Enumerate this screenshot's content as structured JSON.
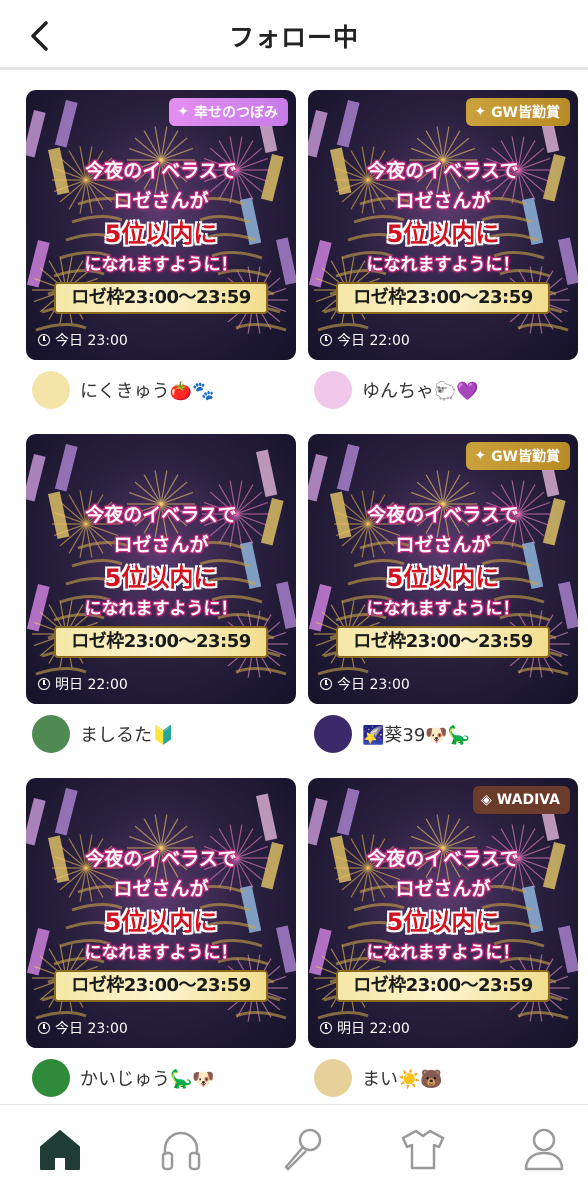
{
  "header": {
    "title": "フォロー中"
  },
  "cards": [
    {
      "badge": "幸せのつぼみ",
      "badge_style": "pink",
      "badge_icon": "sparkle-icon",
      "line1": "今夜のイベラスで",
      "line2": "ロゼさんが",
      "line3": "5位以内に",
      "line4": "になれますように！",
      "slot": "ロゼ枠23:00〜23:59",
      "time": "今日 23:00",
      "user": "にくきゅう🍅🐾",
      "avatar_color": "#f4e4a8"
    },
    {
      "badge": "GW皆勤賞",
      "badge_style": "gold",
      "badge_icon": "sparkle-icon",
      "line1": "今夜のイベラスで",
      "line2": "ロゼさんが",
      "line3": "5位以内に",
      "line4": "になれますように！",
      "slot": "ロゼ枠23:00〜23:59",
      "time": "今日 22:00",
      "user": "ゆんちゃ🐑💜",
      "avatar_color": "#f0c7e8"
    },
    {
      "badge": "",
      "badge_style": "",
      "badge_icon": "",
      "line1": "今夜のイベラスで",
      "line2": "ロゼさんが",
      "line3": "5位以内に",
      "line4": "になれますように！",
      "slot": "ロゼ枠23:00〜23:59",
      "time": "明日 22:00",
      "user": "ましるた🔰",
      "avatar_color": "#4f8a52"
    },
    {
      "badge": "GW皆勤賞",
      "badge_style": "gold",
      "badge_icon": "sparkle-icon",
      "line1": "今夜のイベラスで",
      "line2": "ロゼさんが",
      "line3": "5位以内に",
      "line4": "になれますように！",
      "slot": "ロゼ枠23:00〜23:59",
      "time": "今日 23:00",
      "user": "🌠葵39🐶🦕",
      "avatar_color": "#3a2a6a"
    },
    {
      "badge": "",
      "badge_style": "",
      "badge_icon": "",
      "line1": "今夜のイベラスで",
      "line2": "ロゼさんが",
      "line3": "5位以内に",
      "line4": "になれますように！",
      "slot": "ロゼ枠23:00〜23:59",
      "time": "今日 23:00",
      "user": "かいじゅう🦕🐶",
      "avatar_color": "#2f8a3a"
    },
    {
      "badge": "WADIVA",
      "badge_style": "brown",
      "badge_icon": "diamond-icon",
      "line1": "今夜のイベラスで",
      "line2": "ロゼさんが",
      "line3": "5位以内に",
      "line4": "になれますように！",
      "slot": "ロゼ枠23:00〜23:59",
      "time": "明日 22:00",
      "user": "まい☀️🐻",
      "avatar_color": "#e7d19a"
    }
  ],
  "tabbar": {
    "items": [
      {
        "icon": "home-icon",
        "active": true
      },
      {
        "icon": "headphones-icon",
        "active": false
      },
      {
        "icon": "microphone-icon",
        "active": false
      },
      {
        "icon": "tshirt-icon",
        "active": false
      },
      {
        "icon": "profile-icon",
        "active": false
      }
    ],
    "active_color": "#1f3d35",
    "inactive_color": "#9a9a9a"
  }
}
